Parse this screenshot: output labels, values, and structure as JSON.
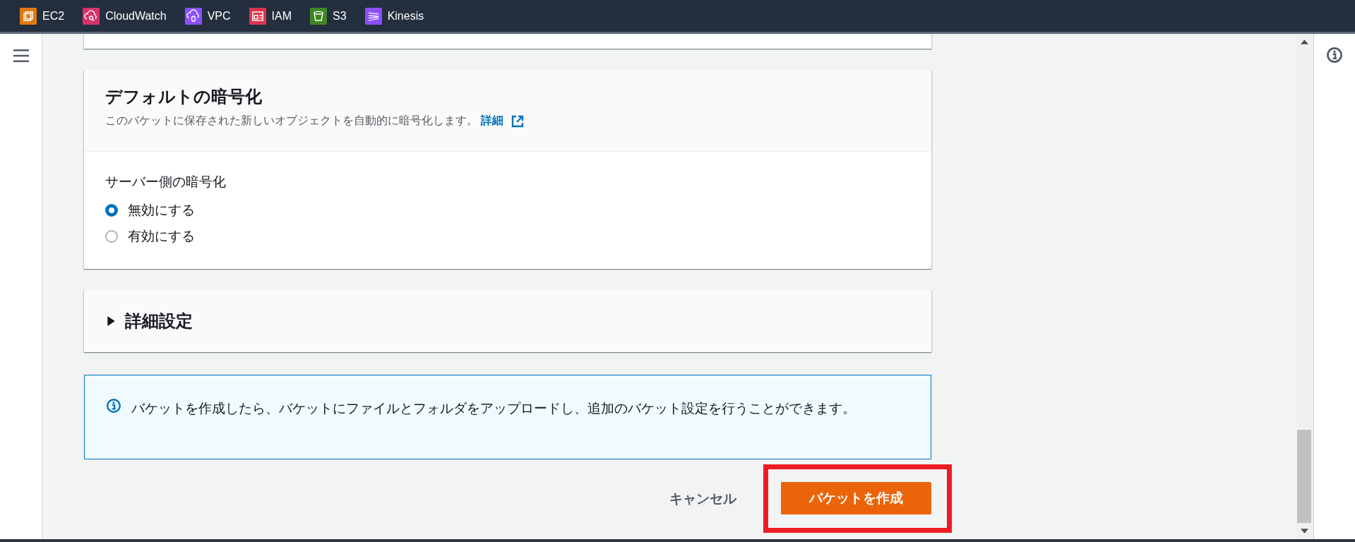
{
  "services": [
    {
      "label": "EC2",
      "color": "#e07a10",
      "kind": "chip"
    },
    {
      "label": "CloudWatch",
      "color": "#d6336c",
      "kind": "monitor"
    },
    {
      "label": "VPC",
      "color": "#8c4fff",
      "kind": "network"
    },
    {
      "label": "IAM",
      "color": "#dd344c",
      "kind": "identity"
    },
    {
      "label": "S3",
      "color": "#3f8624",
      "kind": "storage"
    },
    {
      "label": "Kinesis",
      "color": "#8c4fff",
      "kind": "stream"
    }
  ],
  "encryption": {
    "title": "デフォルトの暗号化",
    "description": "このバケットに保存された新しいオブジェクトを自動的に暗号化します。",
    "link": "詳細",
    "field_label": "サーバー側の暗号化",
    "options": [
      {
        "label": "無効にする",
        "selected": true
      },
      {
        "label": "有効にする",
        "selected": false
      }
    ]
  },
  "advanced": {
    "title": "詳細設定",
    "expanded": false
  },
  "info": "バケットを作成したら、バケットにファイルとフォルダをアップロードし、追加のバケット設定を行うことができます。",
  "buttons": {
    "cancel": "キャンセル",
    "create": "バケットを作成",
    "create_highlighted": true
  }
}
